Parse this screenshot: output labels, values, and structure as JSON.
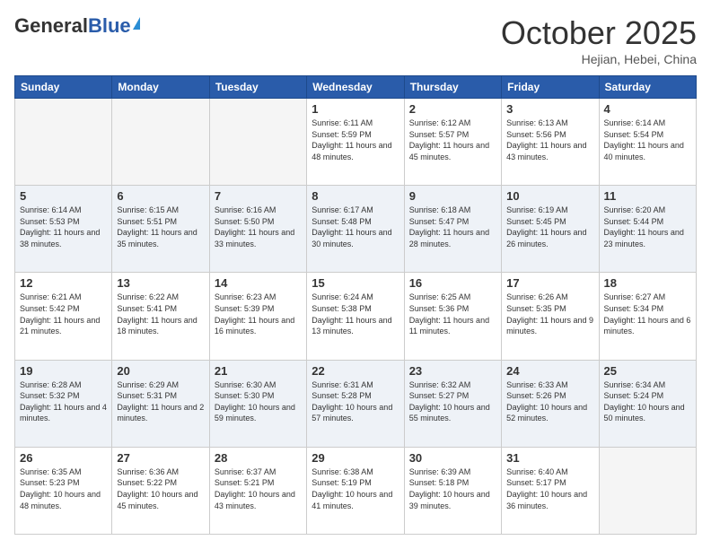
{
  "header": {
    "logo_general": "General",
    "logo_blue": "Blue",
    "month": "October 2025",
    "location": "Hejian, Hebei, China"
  },
  "weekdays": [
    "Sunday",
    "Monday",
    "Tuesday",
    "Wednesday",
    "Thursday",
    "Friday",
    "Saturday"
  ],
  "weeks": [
    [
      {
        "day": "",
        "info": ""
      },
      {
        "day": "",
        "info": ""
      },
      {
        "day": "",
        "info": ""
      },
      {
        "day": "1",
        "info": "Sunrise: 6:11 AM\nSunset: 5:59 PM\nDaylight: 11 hours\nand 48 minutes."
      },
      {
        "day": "2",
        "info": "Sunrise: 6:12 AM\nSunset: 5:57 PM\nDaylight: 11 hours\nand 45 minutes."
      },
      {
        "day": "3",
        "info": "Sunrise: 6:13 AM\nSunset: 5:56 PM\nDaylight: 11 hours\nand 43 minutes."
      },
      {
        "day": "4",
        "info": "Sunrise: 6:14 AM\nSunset: 5:54 PM\nDaylight: 11 hours\nand 40 minutes."
      }
    ],
    [
      {
        "day": "5",
        "info": "Sunrise: 6:14 AM\nSunset: 5:53 PM\nDaylight: 11 hours\nand 38 minutes."
      },
      {
        "day": "6",
        "info": "Sunrise: 6:15 AM\nSunset: 5:51 PM\nDaylight: 11 hours\nand 35 minutes."
      },
      {
        "day": "7",
        "info": "Sunrise: 6:16 AM\nSunset: 5:50 PM\nDaylight: 11 hours\nand 33 minutes."
      },
      {
        "day": "8",
        "info": "Sunrise: 6:17 AM\nSunset: 5:48 PM\nDaylight: 11 hours\nand 30 minutes."
      },
      {
        "day": "9",
        "info": "Sunrise: 6:18 AM\nSunset: 5:47 PM\nDaylight: 11 hours\nand 28 minutes."
      },
      {
        "day": "10",
        "info": "Sunrise: 6:19 AM\nSunset: 5:45 PM\nDaylight: 11 hours\nand 26 minutes."
      },
      {
        "day": "11",
        "info": "Sunrise: 6:20 AM\nSunset: 5:44 PM\nDaylight: 11 hours\nand 23 minutes."
      }
    ],
    [
      {
        "day": "12",
        "info": "Sunrise: 6:21 AM\nSunset: 5:42 PM\nDaylight: 11 hours\nand 21 minutes."
      },
      {
        "day": "13",
        "info": "Sunrise: 6:22 AM\nSunset: 5:41 PM\nDaylight: 11 hours\nand 18 minutes."
      },
      {
        "day": "14",
        "info": "Sunrise: 6:23 AM\nSunset: 5:39 PM\nDaylight: 11 hours\nand 16 minutes."
      },
      {
        "day": "15",
        "info": "Sunrise: 6:24 AM\nSunset: 5:38 PM\nDaylight: 11 hours\nand 13 minutes."
      },
      {
        "day": "16",
        "info": "Sunrise: 6:25 AM\nSunset: 5:36 PM\nDaylight: 11 hours\nand 11 minutes."
      },
      {
        "day": "17",
        "info": "Sunrise: 6:26 AM\nSunset: 5:35 PM\nDaylight: 11 hours\nand 9 minutes."
      },
      {
        "day": "18",
        "info": "Sunrise: 6:27 AM\nSunset: 5:34 PM\nDaylight: 11 hours\nand 6 minutes."
      }
    ],
    [
      {
        "day": "19",
        "info": "Sunrise: 6:28 AM\nSunset: 5:32 PM\nDaylight: 11 hours\nand 4 minutes."
      },
      {
        "day": "20",
        "info": "Sunrise: 6:29 AM\nSunset: 5:31 PM\nDaylight: 11 hours\nand 2 minutes."
      },
      {
        "day": "21",
        "info": "Sunrise: 6:30 AM\nSunset: 5:30 PM\nDaylight: 10 hours\nand 59 minutes."
      },
      {
        "day": "22",
        "info": "Sunrise: 6:31 AM\nSunset: 5:28 PM\nDaylight: 10 hours\nand 57 minutes."
      },
      {
        "day": "23",
        "info": "Sunrise: 6:32 AM\nSunset: 5:27 PM\nDaylight: 10 hours\nand 55 minutes."
      },
      {
        "day": "24",
        "info": "Sunrise: 6:33 AM\nSunset: 5:26 PM\nDaylight: 10 hours\nand 52 minutes."
      },
      {
        "day": "25",
        "info": "Sunrise: 6:34 AM\nSunset: 5:24 PM\nDaylight: 10 hours\nand 50 minutes."
      }
    ],
    [
      {
        "day": "26",
        "info": "Sunrise: 6:35 AM\nSunset: 5:23 PM\nDaylight: 10 hours\nand 48 minutes."
      },
      {
        "day": "27",
        "info": "Sunrise: 6:36 AM\nSunset: 5:22 PM\nDaylight: 10 hours\nand 45 minutes."
      },
      {
        "day": "28",
        "info": "Sunrise: 6:37 AM\nSunset: 5:21 PM\nDaylight: 10 hours\nand 43 minutes."
      },
      {
        "day": "29",
        "info": "Sunrise: 6:38 AM\nSunset: 5:19 PM\nDaylight: 10 hours\nand 41 minutes."
      },
      {
        "day": "30",
        "info": "Sunrise: 6:39 AM\nSunset: 5:18 PM\nDaylight: 10 hours\nand 39 minutes."
      },
      {
        "day": "31",
        "info": "Sunrise: 6:40 AM\nSunset: 5:17 PM\nDaylight: 10 hours\nand 36 minutes."
      },
      {
        "day": "",
        "info": ""
      }
    ]
  ]
}
